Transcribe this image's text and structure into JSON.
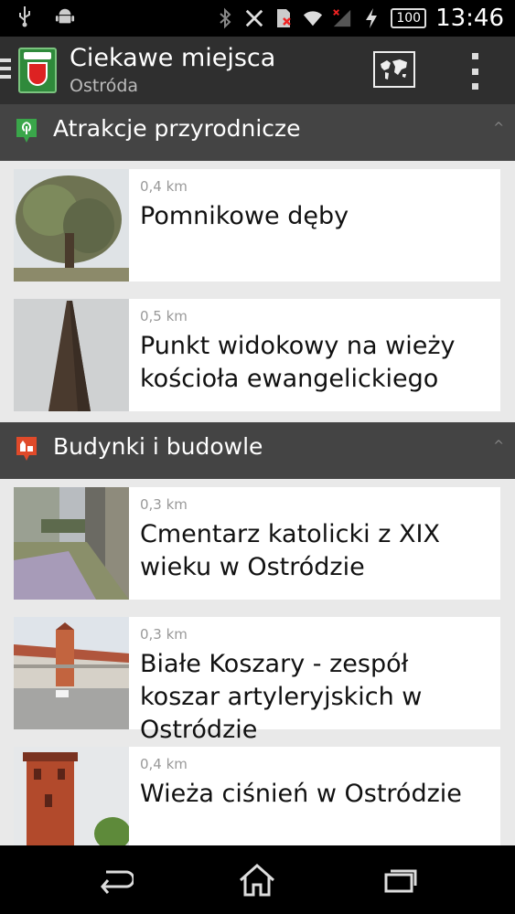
{
  "status_bar": {
    "time": "13:46",
    "battery": "100",
    "icons": [
      "usb-icon",
      "android-icon",
      "bluetooth-icon",
      "nfc-icon",
      "sim-icon",
      "wifi-icon",
      "signal-icon",
      "charging-icon"
    ]
  },
  "action_bar": {
    "title": "Ciekawe miejsca",
    "subtitle": "Ostróda",
    "icons": [
      "menu-icon",
      "app-logo-icon",
      "map-icon",
      "overflow-menu-icon"
    ]
  },
  "sections": [
    {
      "title": "Atrakcje przyrodnicze",
      "icon": "nature-pin-icon",
      "items": [
        {
          "distance": "0,4 km",
          "name": "Pomnikowe dęby"
        },
        {
          "distance": "0,5 km",
          "name": "Punkt widokowy na wieży kościoła ewangelickiego"
        }
      ]
    },
    {
      "title": "Budynki i budowle",
      "icon": "building-pin-icon",
      "items": [
        {
          "distance": "0,3 km",
          "name": "Cmentarz katolicki z XIX wieku w Ostródzie"
        },
        {
          "distance": "0,3 km",
          "name": "Białe Koszary - zespół koszar artyleryjskich w Ostródzie"
        },
        {
          "distance": "0,4 km",
          "name": "Wieża ciśnień w Ostródzie"
        }
      ]
    }
  ],
  "nav_bar": {
    "icons": [
      "back-icon",
      "home-icon",
      "recent-apps-icon"
    ]
  }
}
